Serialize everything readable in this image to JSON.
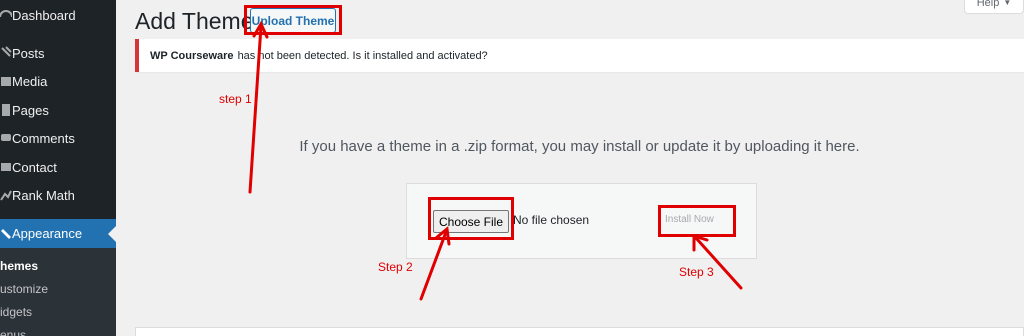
{
  "sidebar": {
    "items": [
      {
        "label": "Dashboard",
        "icon": "dashboard-icon"
      },
      {
        "label": "Posts",
        "icon": "pin-icon"
      },
      {
        "label": "Media",
        "icon": "media-icon"
      },
      {
        "label": "Pages",
        "icon": "page-icon"
      },
      {
        "label": "Comments",
        "icon": "comment-icon"
      },
      {
        "label": "Contact",
        "icon": "mail-icon"
      },
      {
        "label": "Rank Math",
        "icon": "chart-icon"
      },
      {
        "label": "Appearance",
        "icon": "brush-icon"
      }
    ],
    "submenu": [
      "hemes",
      "ustomize",
      "idgets",
      "enus"
    ]
  },
  "header": {
    "title": "Add Themes",
    "upload_button": "Upload Theme",
    "help_label": "Help"
  },
  "notice": {
    "plugin_name": "WP Courseware",
    "message": "has not been detected. Is it installed and activated?"
  },
  "upload": {
    "description": "If you have a theme in a .zip format, you may install or update it by uploading it here.",
    "choose_file": "Choose File",
    "file_status": "No file chosen",
    "install_now": "Install Now"
  },
  "annotations": {
    "step1": "step 1",
    "step2": "Step 2",
    "step3": "Step 3"
  },
  "colors": {
    "sidebar_bg": "#1d2327",
    "active_bg": "#2271b1",
    "notice_error": "#d63638",
    "annotation": "#e00000"
  }
}
